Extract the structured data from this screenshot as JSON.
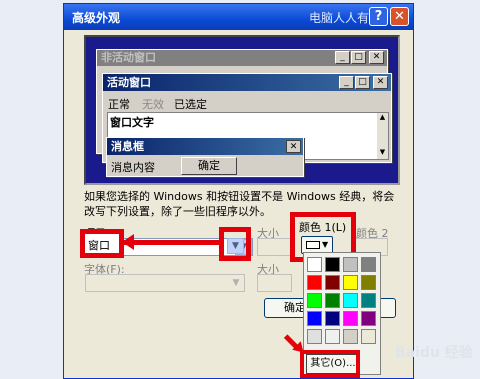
{
  "dialog": {
    "title": "高级外观",
    "title_watermark": "电脑人人有",
    "help_label": "?",
    "close_label": "✕"
  },
  "preview": {
    "inactive_window_title": "非活动窗口",
    "active_window_title": "活动窗口",
    "menu_items": [
      "正常",
      "无效",
      "已选定"
    ],
    "window_text": "窗口文字",
    "message_box_title": "消息框",
    "message_box_text": "消息内容",
    "message_box_ok": "确定",
    "window_buttons": [
      "_",
      "□",
      "✕"
    ]
  },
  "info_text": "如果您选择的 Windows 和按钮设置不是 Windows 经典，将会改写下列设置，除了一些旧程序以外。",
  "item": {
    "label": "项目(I):",
    "value": "窗口",
    "size_label": "大小",
    "font_label": "字体(F):",
    "font_size_label": "大小"
  },
  "color1": {
    "label": "颜色 1(L)",
    "color2_label": "颜色 2"
  },
  "buttons": {
    "ok": "确定",
    "other": "其它(O)..."
  },
  "palette": {
    "colors": [
      [
        "#ffffff",
        "#000000",
        "#c0c0c0",
        "#808080"
      ],
      [
        "#ff0000",
        "#800000",
        "#ffff00",
        "#808000"
      ],
      [
        "#00ff00",
        "#008000",
        "#00ffff",
        "#008080"
      ],
      [
        "#0000ff",
        "#000080",
        "#ff00ff",
        "#800080"
      ],
      [
        "#e0e0e0",
        "#f0f0f0",
        "#d4d0c8",
        "#ece9d8"
      ]
    ]
  },
  "watermark": "Baidu 经验",
  "accent_red": "#e3000b"
}
